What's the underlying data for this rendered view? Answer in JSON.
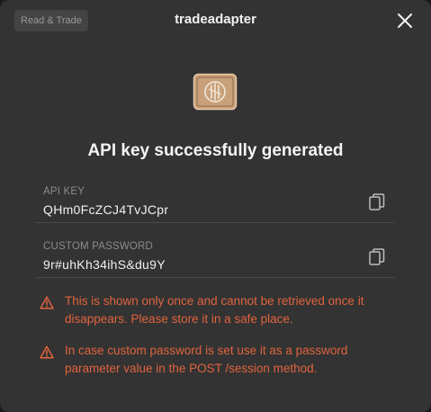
{
  "header": {
    "badge": "Read & Trade",
    "title": "tradeadapter"
  },
  "main": {
    "heading": "API key successfully generated",
    "fields": [
      {
        "label": "API KEY",
        "value": "QHm0FcZCJ4TvJCpr"
      },
      {
        "label": "CUSTOM PASSWORD",
        "value": "9r#uhKh34ihS&du9Y"
      }
    ],
    "warnings": [
      "This is shown only once and cannot be retrieved once it disappears. Please store it in a safe place.",
      "In case custom password is set use it as a password parameter value in the POST /session method."
    ]
  },
  "icons": {
    "close": "close-icon",
    "copy": "copy-icon",
    "warning": "warning-icon",
    "logo": "tradeadapter-logo"
  },
  "colors": {
    "background": "#333333",
    "warning": "#e0633e",
    "logo": "#c8a07a"
  }
}
